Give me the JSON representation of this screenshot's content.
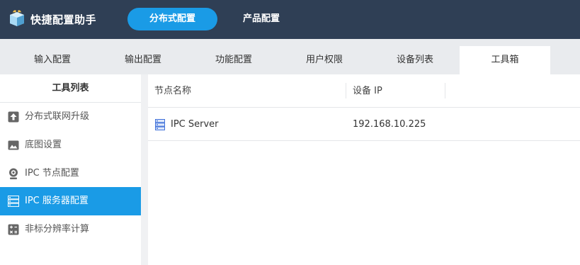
{
  "header": {
    "app_title": "快捷配置助手",
    "tabs": [
      {
        "label": "分布式配置",
        "active": true
      },
      {
        "label": "产品配置",
        "active": false
      }
    ]
  },
  "subnav": {
    "tabs": [
      {
        "label": "输入配置",
        "active": false
      },
      {
        "label": "输出配置",
        "active": false
      },
      {
        "label": "功能配置",
        "active": false
      },
      {
        "label": "用户权限",
        "active": false
      },
      {
        "label": "设备列表",
        "active": false
      },
      {
        "label": "工具箱",
        "active": true
      }
    ]
  },
  "sidebar": {
    "title": "工具列表",
    "items": [
      {
        "label": "分布式联网升级",
        "icon": "upload-icon",
        "active": false
      },
      {
        "label": "底图设置",
        "icon": "image-icon",
        "active": false
      },
      {
        "label": "IPC 节点配置",
        "icon": "webcam-icon",
        "active": false
      },
      {
        "label": "IPC 服务器配置",
        "icon": "server-icon",
        "active": true
      },
      {
        "label": "非标分辨率计算",
        "icon": "calculator-icon",
        "active": false
      }
    ]
  },
  "table": {
    "columns": [
      "节点名称",
      "设备 IP"
    ],
    "rows": [
      {
        "name": "IPC Server",
        "ip": "192.168.10.225",
        "icon": "server-icon"
      }
    ]
  },
  "colors": {
    "header_bg": "#2f3f55",
    "accent": "#1a9be6"
  }
}
